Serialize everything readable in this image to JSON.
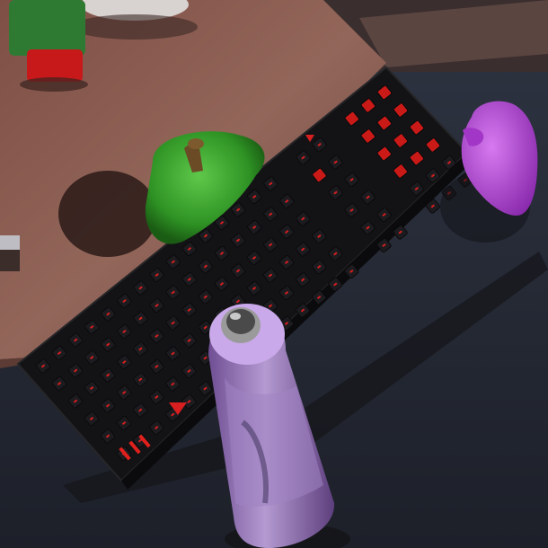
{
  "scene": {
    "colors": {
      "table": "#8a5b4f",
      "table_edge": "#6f4238",
      "floor": "#2b2f3a",
      "keyboard": "#141416",
      "keycap_glow": "#e0201c",
      "pepper": "#2f9a25",
      "bottle": "#8c6ab0",
      "bottle_cap": "#c7a6e6",
      "hand": "#b53fd8",
      "bottle_body": "#9d7bb9"
    },
    "objects": [
      {
        "name": "gaming-keyboard"
      },
      {
        "name": "green-bell-pepper"
      },
      {
        "name": "purple-spray-bottle"
      },
      {
        "name": "purple-robot-hand"
      },
      {
        "name": "green-mug"
      },
      {
        "name": "white-plate"
      }
    ]
  }
}
